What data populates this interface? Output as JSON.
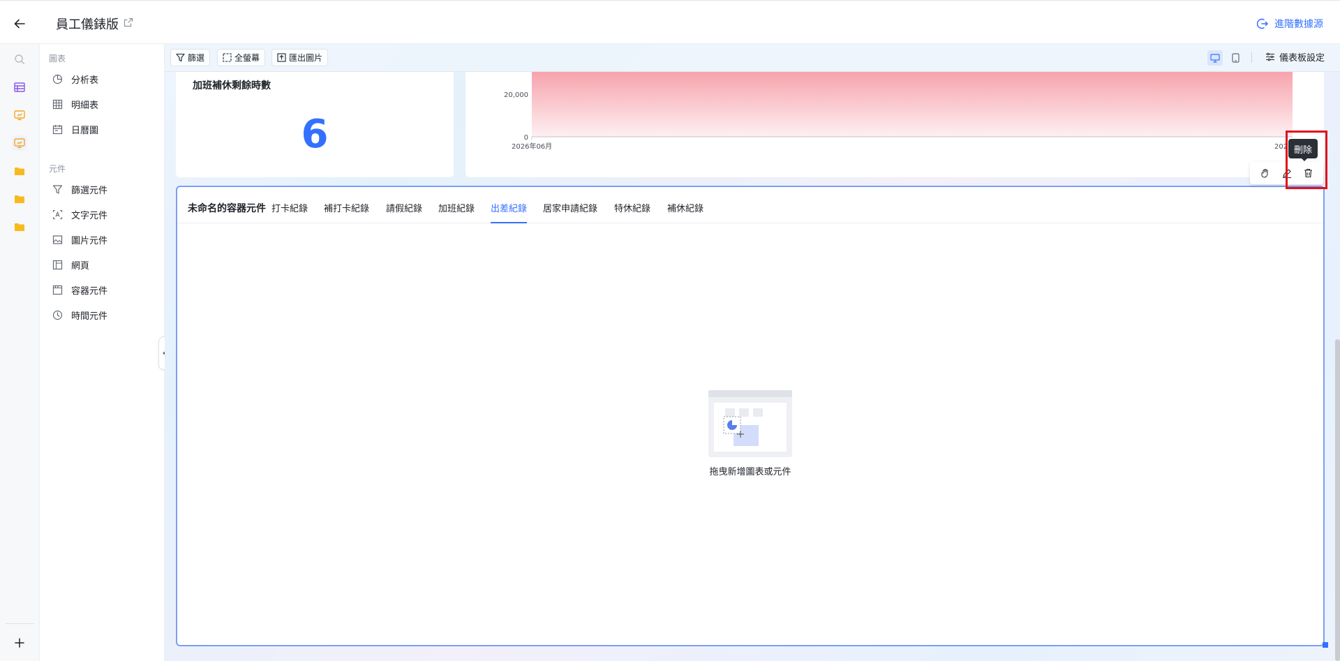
{
  "header": {
    "title": "員工儀錶版",
    "advanced_source_label": "進階數據源"
  },
  "rail": {
    "icons": [
      "search-icon",
      "table-icon",
      "dashboard-icon",
      "dashboard-icon",
      "folder-icon",
      "folder-icon",
      "folder-icon",
      "plus-icon"
    ]
  },
  "panel": {
    "charts_group": "圖表",
    "charts": [
      {
        "label": "分析表",
        "icon": "pie-chart-icon"
      },
      {
        "label": "明細表",
        "icon": "grid-table-icon"
      },
      {
        "label": "日曆圖",
        "icon": "calendar-icon"
      }
    ],
    "components_group": "元件",
    "components": [
      {
        "label": "篩選元件",
        "icon": "filter-icon"
      },
      {
        "label": "文字元件",
        "icon": "text-icon"
      },
      {
        "label": "圖片元件",
        "icon": "image-icon"
      },
      {
        "label": "網頁",
        "icon": "webpage-icon"
      },
      {
        "label": "容器元件",
        "icon": "container-icon"
      },
      {
        "label": "時間元件",
        "icon": "clock-icon"
      }
    ]
  },
  "toolbar": {
    "filter_label": "篩選",
    "fullscreen_label": "全螢幕",
    "export_label": "匯出圖片",
    "settings_label": "儀表板設定"
  },
  "metric_card": {
    "title": "加班補休剩餘時數",
    "value": "6"
  },
  "chart_card": {
    "y_tick_top": "20,000",
    "y_tick_zero": "0",
    "x_tick_left": "2026年06月",
    "x_tick_right_partial": "202"
  },
  "chart_data": {
    "type": "area",
    "x": [
      "2026年06月",
      "202…"
    ],
    "y_ticks": [
      0,
      20000
    ],
    "fill_color": "#f7a3ac",
    "note_visible": "area chart cropped at top; filled to above 20,000 across visible range"
  },
  "chart_actions": {
    "tooltip": "刪除",
    "icons": [
      "drag-icon",
      "edit-icon",
      "delete-icon"
    ]
  },
  "container_card": {
    "name": "未命名的容器元件",
    "tabs": [
      "打卡紀錄",
      "補打卡紀錄",
      "請假紀錄",
      "加班紀錄",
      "出差紀錄",
      "居家申請紀錄",
      "特休紀錄",
      "補休紀錄"
    ],
    "active_tab_index": 4,
    "empty_text": "拖曳新增圖表或元件"
  },
  "colors": {
    "accent": "#3370ff",
    "highlight": "#e0121b",
    "chart_fill": "#f7a3ac"
  }
}
